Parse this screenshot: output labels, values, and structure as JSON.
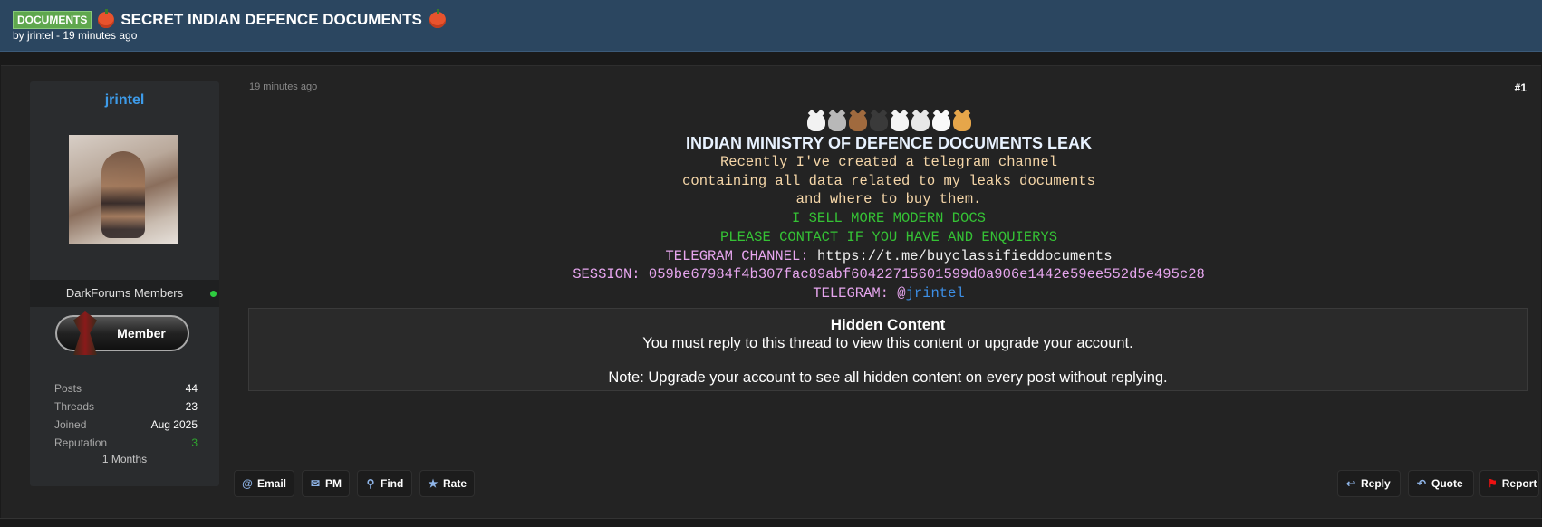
{
  "thread": {
    "prefix": "DOCUMENTS",
    "title": "SECRET INDIAN DEFENCE DOCUMENTS",
    "byline": "by jrintel - 19 minutes ago"
  },
  "author": {
    "username": "jrintel",
    "group": "DarkForums Members",
    "badge": "Member",
    "stats": [
      {
        "label": "Posts",
        "value": "44"
      },
      {
        "label": "Threads",
        "value": "23"
      },
      {
        "label": "Joined",
        "value": "Aug 2025"
      },
      {
        "label": "Reputation",
        "value": "3"
      }
    ],
    "duration": "1 Months"
  },
  "post": {
    "time": "19 minutes ago",
    "number": "#1",
    "heading": "INDIAN MINISTRY OF DEFENCE DOCUMENTS LEAK",
    "lines": [
      "Recently I've created a telegram channel",
      "containing all data related to my leaks documents",
      "and where to buy them."
    ],
    "sell_lines": [
      "I SELL MORE MODERN DOCS",
      "PLEASE CONTACT IF YOU HAVE AND ENQUIERYS"
    ],
    "channel_label": "TELEGRAM CHANNEL: ",
    "channel_url": "https://t.me/buyclassifieddocuments",
    "session_line": "SESSION: 059be67984f4b307fac89abf60422715601599d0a906e1442e59ee552d5e495c28",
    "telegram_label": "TELEGRAM: ",
    "telegram_at": "@",
    "telegram_handle": "jrintel"
  },
  "hidden": {
    "title": "Hidden Content",
    "message": "You must reply to this thread to view this content or upgrade your account.",
    "note": "Note: Upgrade your account to see all hidden content on every post without replying."
  },
  "buttons": {
    "email": "Email",
    "pm": "PM",
    "find": "Find",
    "rate": "Rate",
    "reply": "Reply",
    "quote": "Quote",
    "report": "Report"
  }
}
